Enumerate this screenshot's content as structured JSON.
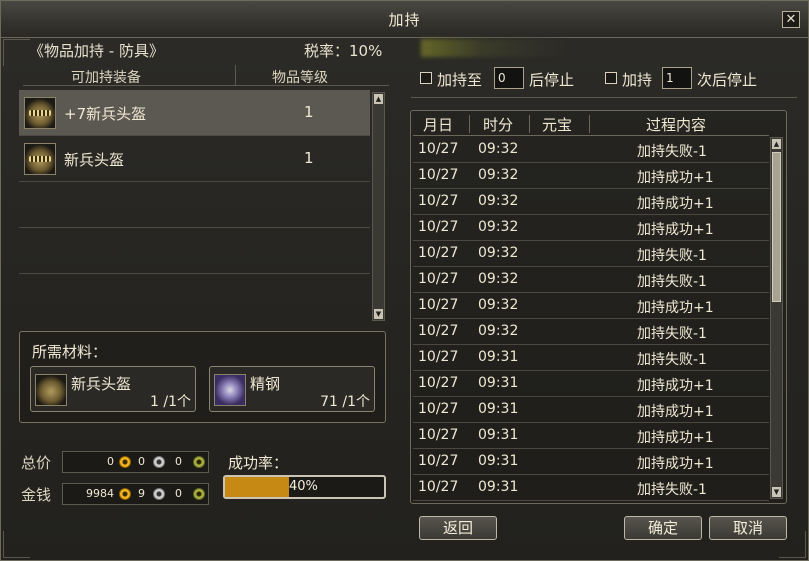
{
  "window": {
    "title": "加持",
    "close_label": "✕"
  },
  "left": {
    "category": "《物品加持 - 防具》",
    "tax_rate": "税率：10%",
    "headers": {
      "equip": "可加持装备",
      "level": "物品等级"
    },
    "items": [
      {
        "name": "+7新兵头盔",
        "level": "1",
        "selected": true
      },
      {
        "name": "新兵头盔",
        "level": "1",
        "selected": false
      }
    ]
  },
  "materials": {
    "title": "所需材料：",
    "items": [
      {
        "name": "新兵头盔",
        "count": "1 /1个",
        "icon": "helmet-icon"
      },
      {
        "name": "精钢",
        "count": "71 /1个",
        "icon": "steel-ore-icon"
      }
    ]
  },
  "money": {
    "total_label": "总价",
    "gold_label": "金钱",
    "total": {
      "gold": "0",
      "silver": "0",
      "copper": "0"
    },
    "owned": {
      "gold": "9984",
      "silver": "9",
      "copper": "0"
    }
  },
  "success": {
    "label": "成功率：",
    "rate_text": "40%",
    "rate": 0.4
  },
  "options": {
    "stop_at_prefix": "加持至",
    "stop_at_value": "0",
    "stop_at_suffix": "后停止",
    "stop_after_prefix": "加持",
    "stop_after_value": "1",
    "stop_after_suffix": "次后停止"
  },
  "log": {
    "headers": {
      "date": "月日",
      "time": "时分",
      "ingot": "元宝",
      "detail": "过程内容"
    },
    "rows": [
      {
        "date": "10/27",
        "time": "09:32",
        "detail": "加持失败-1"
      },
      {
        "date": "10/27",
        "time": "09:32",
        "detail": "加持成功+1"
      },
      {
        "date": "10/27",
        "time": "09:32",
        "detail": "加持成功+1"
      },
      {
        "date": "10/27",
        "time": "09:32",
        "detail": "加持成功+1"
      },
      {
        "date": "10/27",
        "time": "09:32",
        "detail": "加持失败-1"
      },
      {
        "date": "10/27",
        "time": "09:32",
        "detail": "加持失败-1"
      },
      {
        "date": "10/27",
        "time": "09:32",
        "detail": "加持成功+1"
      },
      {
        "date": "10/27",
        "time": "09:32",
        "detail": "加持失败-1"
      },
      {
        "date": "10/27",
        "time": "09:31",
        "detail": "加持失败-1"
      },
      {
        "date": "10/27",
        "time": "09:31",
        "detail": "加持成功+1"
      },
      {
        "date": "10/27",
        "time": "09:31",
        "detail": "加持成功+1"
      },
      {
        "date": "10/27",
        "time": "09:31",
        "detail": "加持成功+1"
      },
      {
        "date": "10/27",
        "time": "09:31",
        "detail": "加持成功+1"
      },
      {
        "date": "10/27",
        "time": "09:31",
        "detail": "加持失败-1"
      }
    ]
  },
  "buttons": {
    "back": "返回",
    "confirm": "确定",
    "cancel": "取消"
  },
  "colors": {
    "progress": "#c68a14",
    "selected_row": "#5c5953"
  }
}
